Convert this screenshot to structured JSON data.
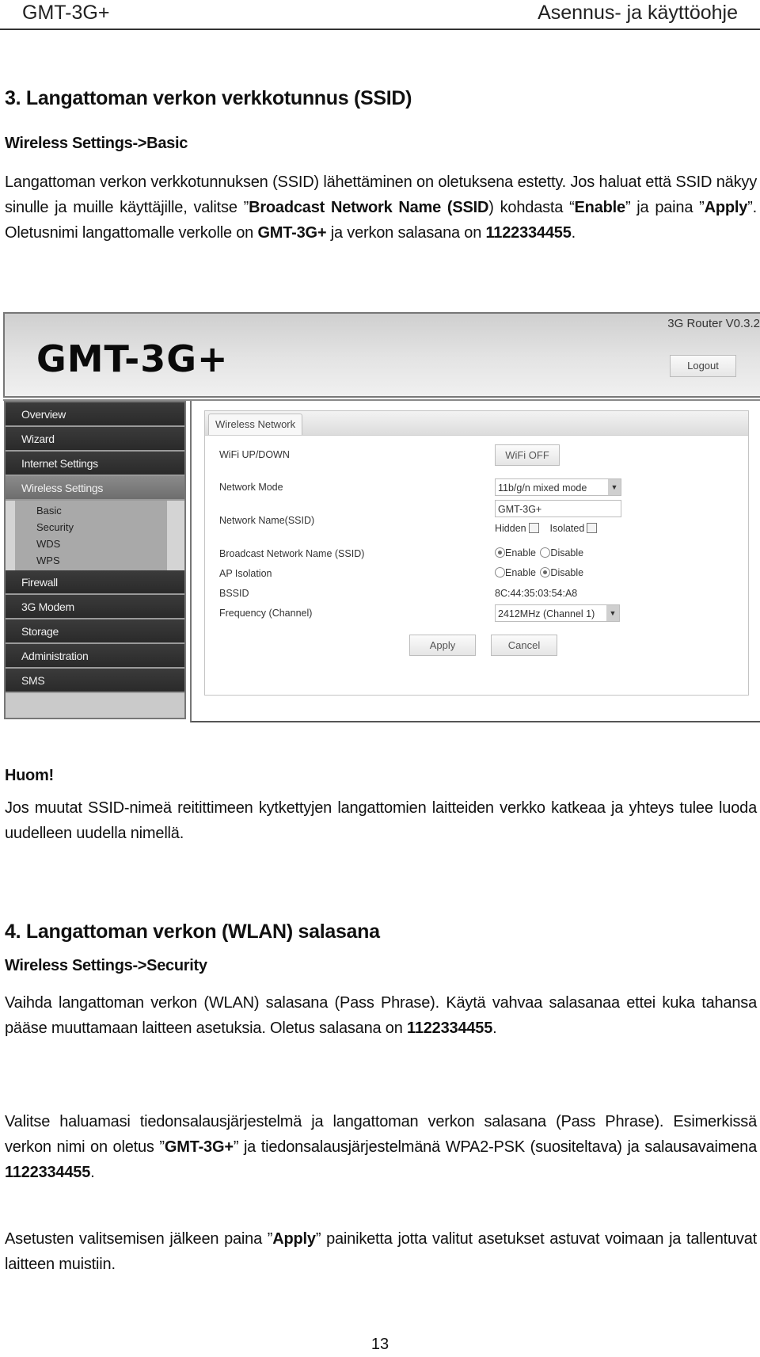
{
  "page_header": {
    "left": "GMT-3G+",
    "right": "Asennus- ja käyttöohje"
  },
  "section3": {
    "title": "3.  Langattoman verkon verkkotunnus (SSID)",
    "path": "Wireless Settings->Basic",
    "paragraph": {
      "t1": "Langattoman verkon verkkotunnuksen (SSID) lähettäminen on oletuksena estetty. Jos haluat että SSID näkyy sinulle ja muille käyttäjille, valitse ”",
      "b1": "Broadcast Network Name (SSID",
      "t2": ") kohdasta “",
      "b2": "Enable",
      "t3": "” ja paina ”",
      "b3": "Apply",
      "t4": "”. Oletusnimi langattomalle verkolle on ",
      "b4": "GMT-3G+",
      "t5": " ja verkon salasana on ",
      "b5": "1122334455",
      "t6": "."
    }
  },
  "router_ui": {
    "brand": "GMT-3G+",
    "version": "3G Router V0.3.2",
    "logout_label": "Logout",
    "sidebar": {
      "items_top": [
        {
          "label": "Overview"
        },
        {
          "label": "Wizard"
        },
        {
          "label": "Internet Settings"
        },
        {
          "label": "Wireless Settings",
          "active": true
        }
      ],
      "sub_items": [
        {
          "label": "Basic"
        },
        {
          "label": "Security"
        },
        {
          "label": "WDS"
        },
        {
          "label": "WPS"
        }
      ],
      "items_bottom": [
        {
          "label": "Firewall"
        },
        {
          "label": "3G Modem"
        },
        {
          "label": "Storage"
        },
        {
          "label": "Administration"
        },
        {
          "label": "SMS"
        }
      ]
    },
    "tab_label": "Wireless Network",
    "form": {
      "wifi_updown_label": "WiFi UP/DOWN",
      "wifi_button": "WiFi OFF",
      "network_mode_label": "Network Mode",
      "network_mode_value": "11b/g/n mixed mode",
      "ssid_label": "Network Name(SSID)",
      "ssid_value": "GMT-3G+",
      "hidden_label": "Hidden",
      "hidden_checked": false,
      "isolated_label": "Isolated",
      "isolated_checked": false,
      "broadcast_label": "Broadcast Network Name (SSID)",
      "broadcast_value": "Enable",
      "ap_isolation_label": "AP Isolation",
      "ap_isolation_value": "Disable",
      "enable_label": "Enable",
      "disable_label": "Disable",
      "bssid_label": "BSSID",
      "bssid_value": "8C:44:35:03:54:A8",
      "frequency_label": "Frequency (Channel)",
      "frequency_value": "2412MHz (Channel 1)",
      "apply_label": "Apply",
      "cancel_label": "Cancel"
    }
  },
  "note": {
    "title": "Huom!",
    "text": "Jos muutat SSID-nimeä reitittimeen kytkettyjen langattomien laitteiden verkko katkeaa ja yhteys tulee luoda uudelleen uudella nimellä."
  },
  "section4": {
    "title": "4.  Langattoman verkon (WLAN) salasana",
    "path": "Wireless Settings->Security",
    "p1": {
      "t1": "Vaihda langattoman verkon (WLAN) salasana (Pass Phrase). Käytä vahvaa salasanaa ettei kuka tahansa pääse muuttamaan laitteen asetuksia. Oletus salasana on ",
      "b1": "1122334455",
      "t2": "."
    },
    "p2": {
      "t1": "Valitse haluamasi tiedonsalausjärjestelmä ja langattoman verkon salasana (Pass Phrase). Esimerkissä verkon nimi on oletus ”",
      "b1": "GMT-3G+",
      "t2": "” ja tiedonsalausjärjestelmänä WPA2-PSK (suositeltava) ja salausavaimena ",
      "b2": "1122334455",
      "t3": "."
    },
    "p3": {
      "t1": "Asetusten valitsemisen jälkeen paina ”",
      "b1": "Apply",
      "t2": "” painiketta jotta valitut asetukset astuvat voimaan ja tallentuvat laitteen muistiin."
    }
  },
  "page_number": "13"
}
